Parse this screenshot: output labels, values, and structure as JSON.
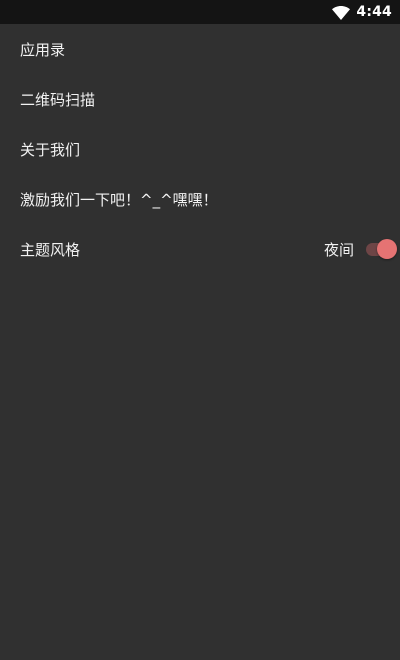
{
  "status_bar": {
    "time": "4:44",
    "wifi_icon": "wifi-icon"
  },
  "menu": {
    "items": [
      {
        "label": "应用录"
      },
      {
        "label": "二维码扫描"
      },
      {
        "label": "关于我们"
      },
      {
        "label": "激励我们一下吧！^_^嘿嘿！"
      },
      {
        "label": "主题风格",
        "value": "夜间",
        "toggle_on": true
      }
    ]
  },
  "colors": {
    "background": "#303030",
    "status_bar": "#141414",
    "accent": "#e57373",
    "toggle_track": "#6e4546",
    "text": "#f2f2f2"
  }
}
